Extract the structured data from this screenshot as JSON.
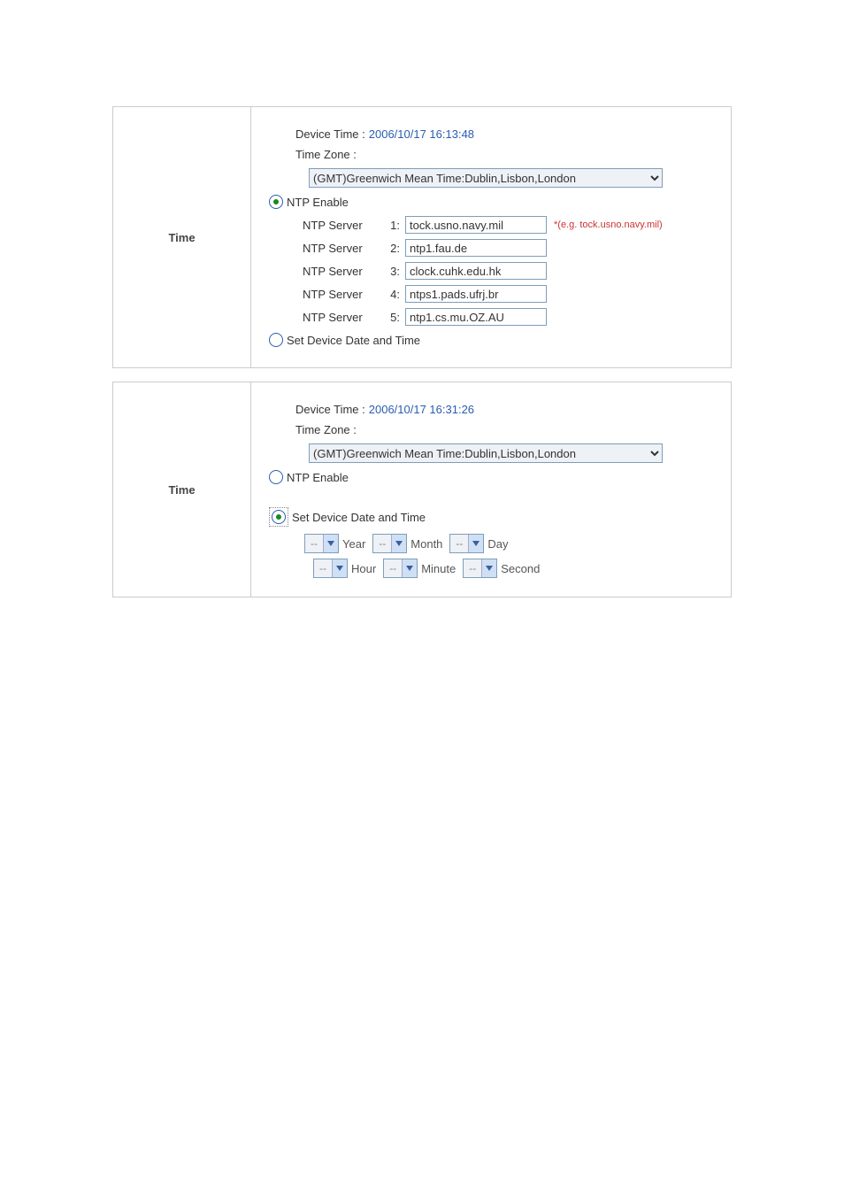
{
  "panel1": {
    "title": "Time",
    "device_time_label": "Device Time :",
    "device_time_value": "2006/10/17 16:13:48",
    "tz_label": "Time Zone :",
    "tz_value": "(GMT)Greenwich Mean Time:Dublin,Lisbon,London",
    "ntp_enable": "NTP Enable",
    "servers": [
      {
        "label": "NTP Server",
        "num": "1:",
        "value": "tock.usno.navy.mil",
        "hint": "*(e.g. tock.usno.navy.mil)"
      },
      {
        "label": "NTP Server",
        "num": "2:",
        "value": "ntp1.fau.de"
      },
      {
        "label": "NTP Server",
        "num": "3:",
        "value": "clock.cuhk.edu.hk"
      },
      {
        "label": "NTP Server",
        "num": "4:",
        "value": "ntps1.pads.ufrj.br"
      },
      {
        "label": "NTP Server",
        "num": "5:",
        "value": "ntp1.cs.mu.OZ.AU"
      }
    ],
    "set_device": "Set Device Date and Time"
  },
  "panel2": {
    "title": "Time",
    "device_time_label": "Device Time :",
    "device_time_value": "2006/10/17 16:31:26",
    "tz_label": "Time Zone :",
    "tz_value": "(GMT)Greenwich Mean Time:Dublin,Lisbon,London",
    "ntp_enable": "NTP Enable",
    "set_device": "Set Device Date and Time",
    "date_row": {
      "placeholder": "--",
      "year": "Year",
      "month": "Month",
      "day": "Day"
    },
    "time_row": {
      "placeholder": "--",
      "hour": "Hour",
      "minute": "Minute",
      "second": "Second"
    }
  }
}
